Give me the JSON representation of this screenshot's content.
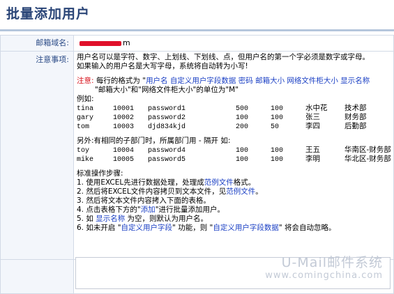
{
  "page": {
    "title": "批量添加用户"
  },
  "form": {
    "domain_label": "邮箱域名:",
    "domain_suffix": "m",
    "notes_label": "注意事项:"
  },
  "notes": {
    "line1": "用户名可以是字符、数字、上划线、下划线、点，但用户名的第一个字必须是数字或字母。",
    "line2": "如果输入的用户名是大写字母，系统将自动转为小写!",
    "format_prefix": "注意:",
    "format_text": " 每行的格式为 \"",
    "format_fields": "用户名 自定义用户字段数据 密码 邮箱大小 网络文件柜大小 显示名称",
    "format_line2": "\"邮箱大小\"和\"网络文件柜大小\"的单位为\"M\"",
    "example_label": "例如:",
    "examples": [
      [
        "tina",
        "10001",
        "password1",
        "500",
        "100",
        "水中花",
        "技术部"
      ],
      [
        "gary",
        "10002",
        "password2",
        "100",
        "100",
        "张三",
        "财务部"
      ],
      [
        "tom",
        "10003",
        "djd834kjd",
        "200",
        "50",
        "李四",
        "后勤部"
      ]
    ],
    "subdept_label": "另外:有相同的子部门时，所属部门用 - 隔开 如:",
    "subdept_examples": [
      [
        "toy",
        "10004",
        "password4",
        "100",
        "100",
        "王五",
        "华南区-财务部"
      ],
      [
        "mike",
        "10005",
        "password5",
        "100",
        "100",
        "李明",
        "华北区-财务部"
      ]
    ],
    "steps_label": "标准操作步骤:",
    "step1_a": "1. 使用EXCEL先进行数据处理，处理成",
    "step1_link": "范例文件",
    "step1_b": "格式。",
    "step2_a": "2. 然后将EXCEL文件内容拷贝到文本文件，见",
    "step2_link": "范例文件",
    "step2_b": "。",
    "step3": "3. 然后将文本文件内容拷入下面的表格。",
    "step4_a": "4. 点击表格下方的\"",
    "step4_link": "添加",
    "step4_b": "\"进行批量添加用户。",
    "step5_a": "5. 如 ",
    "step5_link": "显示名称",
    "step5_b": " 为空，则默认为用户名。",
    "step6_a": "6. 如未开启 \"",
    "step6_link1": "自定义用户字段",
    "step6_b": "\" 功能，则 \"",
    "step6_link2": "自定义用户字段数据",
    "step6_c": "\" 将会自动忽略。"
  },
  "watermark": {
    "main": "U-Mail邮件系统",
    "sub": "www.comingchina.com"
  },
  "colors": {
    "title": "#2a4577",
    "label": "#2a4a86",
    "red": "#d8111b",
    "link": "#1a3fc4"
  }
}
